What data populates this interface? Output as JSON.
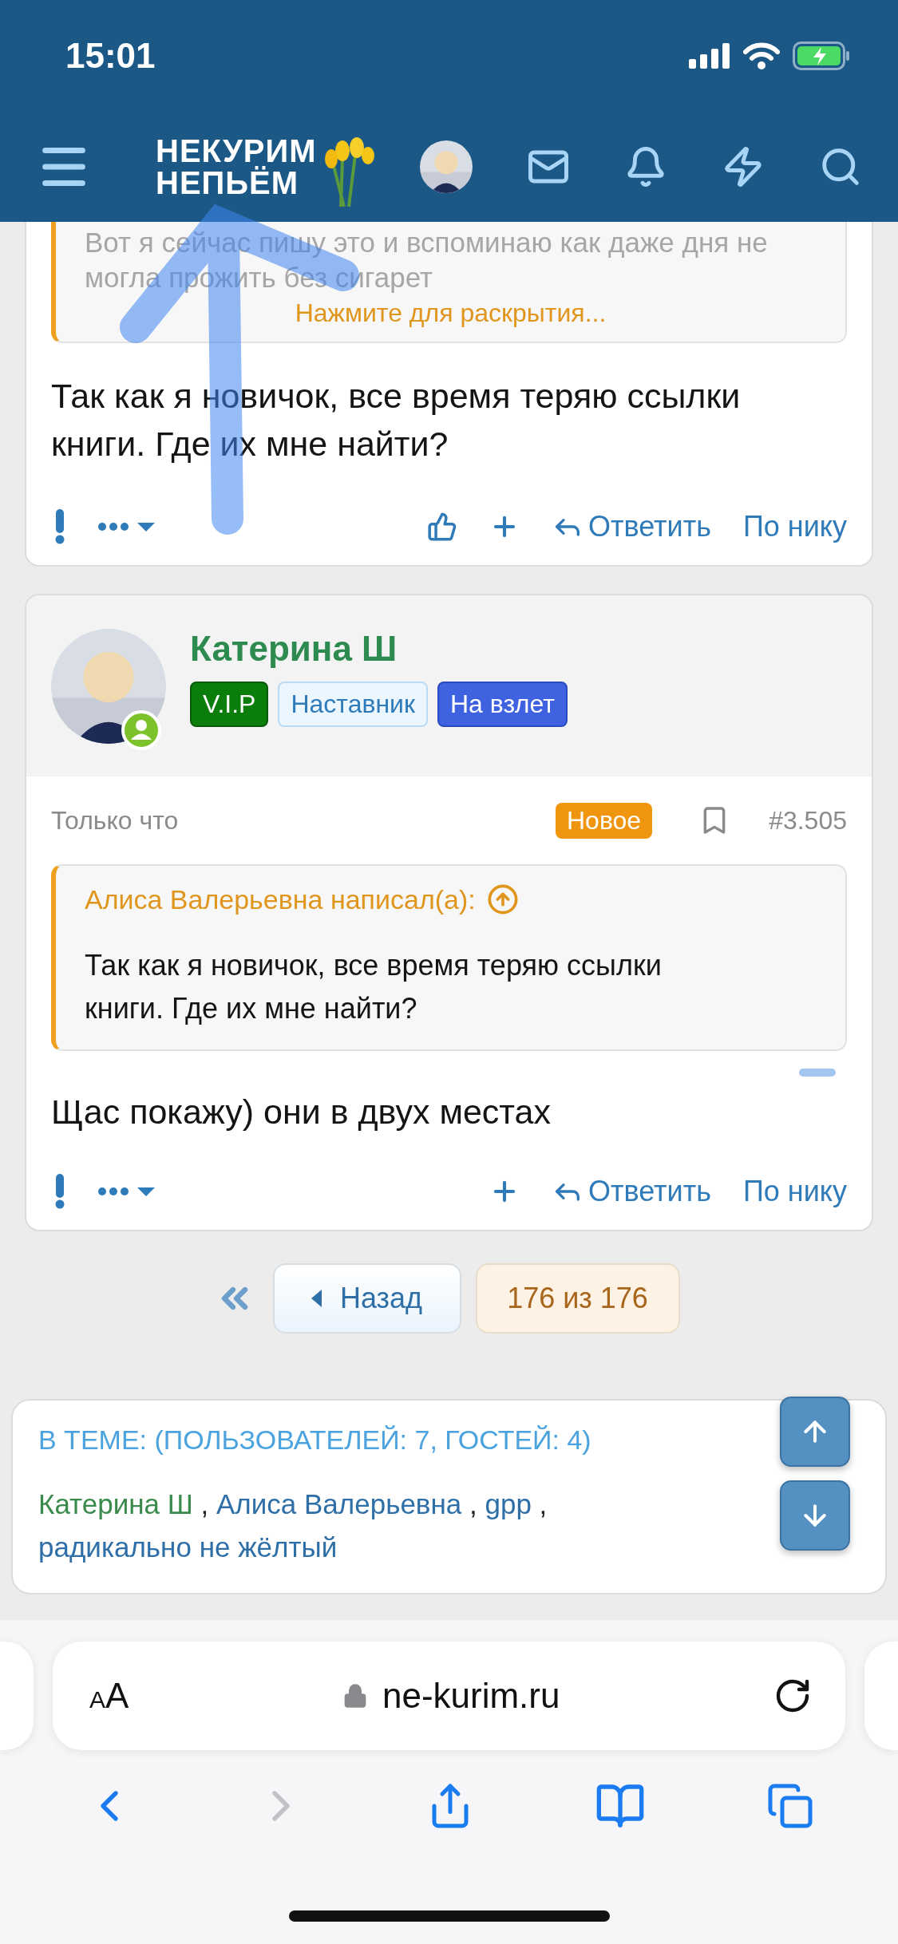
{
  "status_bar": {
    "time": "15:01"
  },
  "header": {
    "logo": [
      "НЕКУРИМ",
      "НЕПЬЁМ"
    ]
  },
  "posts": [
    {
      "quote": {
        "text": "Вот я сейчас пишу это и вспоминаю как даже дня не могла прожить без сигарет",
        "expand": "Нажмите для раскрытия..."
      },
      "text": "Так как я новичок, все время теряю ссылки книги. Где их мне найти?",
      "actions": [
        {
          "kind": "like"
        },
        {
          "kind": "plus"
        },
        {
          "kind": "reply",
          "label": "Ответить"
        },
        {
          "kind": "link",
          "label": "По нику"
        }
      ]
    },
    {
      "author": {
        "name": "Катерина Ш",
        "online": true,
        "badges": [
          {
            "kind": "vip",
            "label": "V.I.P"
          },
          {
            "kind": "mentor",
            "label": "Наставник"
          },
          {
            "kind": "rank",
            "label": "На взлет"
          }
        ]
      },
      "time": "Только что",
      "new_label": "Новое",
      "number": "#3.505",
      "quote": {
        "author": "Алиса Валерьевна написал(а):",
        "text": "Так как я новичок, все время теряю ссылки книги. Где их мне найти?"
      },
      "text": "Щас покажу) они в двух местах",
      "actions": [
        {
          "kind": "plus"
        },
        {
          "kind": "reply",
          "label": "Ответить"
        },
        {
          "kind": "link",
          "label": "По нику"
        }
      ]
    }
  ],
  "pagination": {
    "back": "Назад",
    "page": "176 из 176"
  },
  "online": {
    "title": "В ТЕМЕ: (ПОЛЬЗОВАТЕЛЕЙ: 7, ГОСТЕЙ: 4)",
    "separator": ",",
    "users": [
      {
        "name": "Катерина Ш",
        "color": "#3a8a4c"
      },
      {
        "name": "Алиса Валерьевна",
        "color": "#2f6fa8"
      },
      {
        "name": "gpp",
        "color": "#2f6fa8"
      },
      {
        "name": "радикально не жёлтый",
        "color": "#2f6fa8"
      }
    ]
  },
  "browser": {
    "text_size": "AA",
    "url": "ne-kurim.ru"
  }
}
